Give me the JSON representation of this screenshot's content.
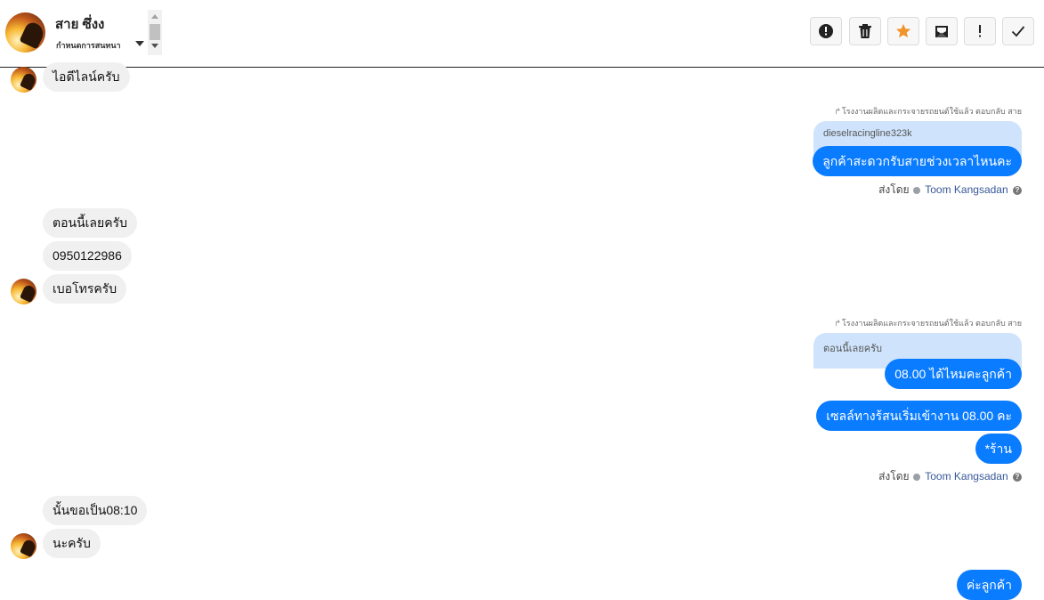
{
  "header": {
    "contact_name": "สาย ซึ่งง",
    "assign_label": "กำหนดการสนทนา",
    "tools": [
      {
        "icon": "alert-circle-icon"
      },
      {
        "icon": "trash-icon"
      },
      {
        "icon": "star-icon",
        "color": "#f0932b"
      },
      {
        "icon": "mark-unread-icon"
      },
      {
        "icon": "exclamation-icon"
      },
      {
        "icon": "check-icon"
      }
    ]
  },
  "messages": {
    "in_1": "ไอดีไลน์ครับ",
    "reply_meta_1": "โรงงานผลิตและกระจายรถยนต์ใช้แล้ว ตอบกลับ สาย",
    "quote_1": "dieselracingline323k",
    "out_1": "ลูกค้าสะดวกรับสายช่วงเวลาไหนคะ",
    "sent_by_label_1": "ส่งโดย",
    "sent_by_name_1": "Toom Kangsadan",
    "in_2": "ตอนนี้เลยครับ",
    "in_3": "0950122986",
    "in_4": "เบอโทรครับ",
    "reply_meta_2": "โรงงานผลิตและกระจายรถยนต์ใช้แล้ว ตอบกลับ สาย",
    "quote_2": "ตอนนี้เลยครับ",
    "out_2": "08.00 ได้ไหมคะลูกค้า",
    "out_3": "เซลล์ทางร้สนเริ่มเข้างาน 08.00 คะ",
    "out_4": "*ร้าน",
    "sent_by_label_2": "ส่งโดย",
    "sent_by_name_2": "Toom Kangsadan",
    "in_5": "นั้นขอเป็น08:10",
    "in_6": "นะครับ",
    "out_5": "ค่ะลูกค้า"
  },
  "colors": {
    "outgoing_bubble": "#0a7cff",
    "incoming_bubble": "#f0f0f0",
    "quote_bubble": "#cfe4fc",
    "star": "#f0932b"
  }
}
